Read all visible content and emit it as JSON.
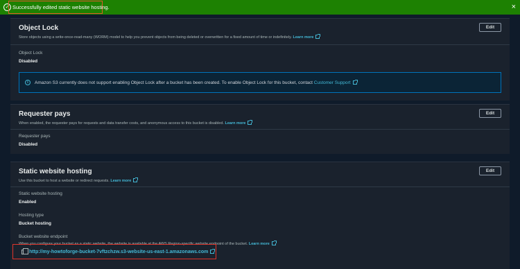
{
  "flash": {
    "message": "Successfully edited static website hosting.",
    "status_icon": "success-check-icon",
    "close_icon": "close-icon",
    "close_glyph": "×",
    "bg_color": "#1d8102"
  },
  "object_lock": {
    "title": "Object Lock",
    "description": "Store objects using a write-once-read-many (WORM) model to help you prevent objects from being deleted or overwritten for a fixed amount of time or indefinitely.",
    "learn_more": "Learn more",
    "edit_label": "Edit",
    "field_label": "Object Lock",
    "field_value": "Disabled",
    "info_text": "Amazon S3 currently does not support enabling Object Lock after a bucket has been created. To enable Object Lock for this bucket, contact",
    "info_link": "Customer Support"
  },
  "requester_pays": {
    "title": "Requester pays",
    "description": "When enabled, the requester pays for requests and data transfer costs, and anonymous access to this bucket is disabled.",
    "learn_more": "Learn more",
    "edit_label": "Edit",
    "field_label": "Requester pays",
    "field_value": "Disabled"
  },
  "static_hosting": {
    "title": "Static website hosting",
    "description": "Use this bucket to host a website or redirect requests.",
    "learn_more": "Learn more",
    "edit_label": "Edit",
    "status_label": "Static website hosting",
    "status_value": "Enabled",
    "hosting_type_label": "Hosting type",
    "hosting_type_value": "Bucket hosting",
    "endpoint_label": "Bucket website endpoint",
    "endpoint_desc": "When you configure your bucket as a static website, the website is available at the AWS Region-specific website endpoint of the bucket.",
    "endpoint_learn_more": "Learn more",
    "endpoint_url": "http://my-howtoforge-bucket-7vftzchzw.s3-website-us-east-1.amazonaws.com"
  },
  "colors": {
    "link": "#44b9d6",
    "highlight_border": "#e0352b",
    "info_border": "#0073bb"
  }
}
